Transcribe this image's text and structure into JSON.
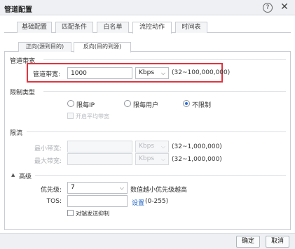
{
  "window": {
    "title": "管道配置"
  },
  "tabs": [
    "基础配置",
    "匹配条件",
    "白名单",
    "流控动作",
    "时间表"
  ],
  "active_tab": "流控动作",
  "subtabs": [
    "正向(源到目的)",
    "反向(目的到源)"
  ],
  "active_subtab": "反向(目的到源)",
  "bandwidth": {
    "section_title": "管道带宽",
    "label": "管道带宽:",
    "value": "1000",
    "unit": "Kbps",
    "range": "(32~100,000,000)"
  },
  "limit_type": {
    "section_title": "限制类型",
    "options": [
      "限每IP",
      "限每用户",
      "不限制"
    ],
    "selected": "不限制",
    "avg_allocation_label": "开启平均带宽"
  },
  "rate_limit": {
    "section_title": "限流",
    "min_label": "最小带宽:",
    "min_value": "",
    "min_unit": "Kbps",
    "min_range": "(32~1,000,000)",
    "max_label": "最大带宽:",
    "max_value": "",
    "max_unit": "Kbps",
    "max_range": "(32~1,000,000)"
  },
  "advanced": {
    "section_title": "高级",
    "priority_label": "优先级:",
    "priority_value": "7",
    "priority_hint": "数值越小优先级越高",
    "tos_label": "TOS:",
    "tos_value": "",
    "tos_link": "设置",
    "tos_range": "(0-255)",
    "suppress_label": "对端发送抑制"
  },
  "footer": {
    "ok_label": "确定",
    "cancel_label": "取消"
  },
  "colors": {
    "highlight": "#e0343f",
    "link": "#1f63c6",
    "radio_selected": "#2f6fd6"
  }
}
